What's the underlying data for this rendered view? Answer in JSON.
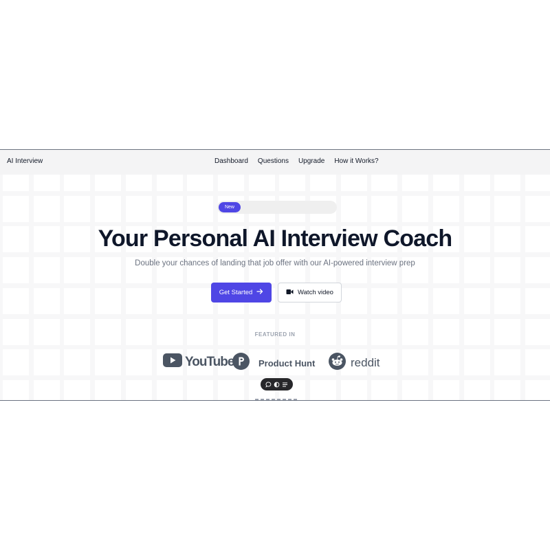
{
  "nav": {
    "brand": "AI Interview",
    "links": [
      "Dashboard",
      "Questions",
      "Upgrade",
      "How it Works?"
    ]
  },
  "hero": {
    "badge": "New",
    "headline": "Your Personal AI Interview Coach",
    "subheadline": "Double your chances of landing that job offer with our AI-powered interview prep",
    "primary_button": "Get Started",
    "secondary_button": "Watch video",
    "featured_label": "FEATURED IN",
    "logos": {
      "youtube": "YouTube",
      "producthunt": "Product Hunt",
      "reddit": "reddit"
    }
  },
  "icons": {
    "arrow": "arrow-right-icon",
    "video": "video-camera-icon",
    "youtube": "youtube-play-icon",
    "producthunt": "producthunt-p-icon",
    "reddit": "reddit-alien-icon",
    "toolbar": [
      "chat-bubble-icon",
      "toggle-icon",
      "list-icon"
    ]
  },
  "colors": {
    "accent": "#4f46e5",
    "text": "#0f172a",
    "muted": "#6b7280",
    "logo_gray": "#4b5563"
  }
}
